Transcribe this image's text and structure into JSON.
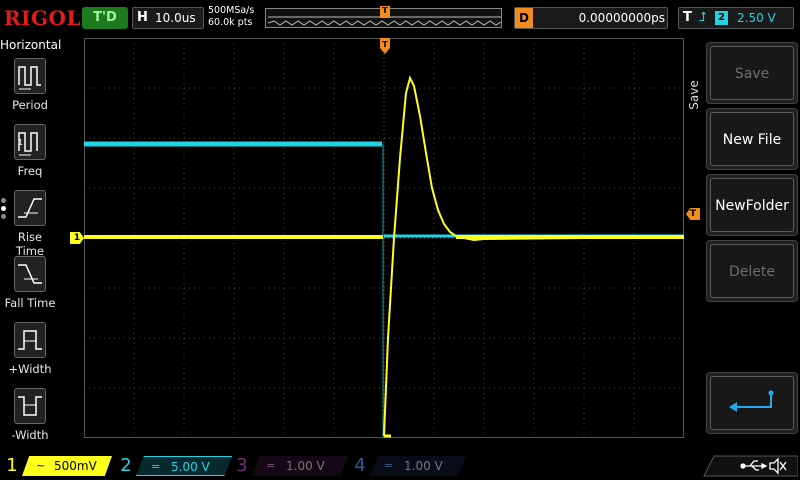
{
  "header": {
    "logo": "RIGOL",
    "run_status": "T'D",
    "timebase_label": "H",
    "timebase_value": "10.0us",
    "sample_rate": "500MSa/s",
    "memory_depth": "60.0k pts",
    "memory_trigger_label": "T",
    "delay_label": "D",
    "delay_value": "0.00000000ps",
    "trigger_label": "T",
    "trigger_source": "2",
    "trigger_level": "2.50 V"
  },
  "left_menu": {
    "title": "Horizontal",
    "items": [
      {
        "label": "Period",
        "icon": "period-icon"
      },
      {
        "label": "Freq",
        "icon": "frequency-icon"
      },
      {
        "label": "Rise Time",
        "icon": "rise-time-icon"
      },
      {
        "label": "Fall Time",
        "icon": "fall-time-icon"
      },
      {
        "label": "+Width",
        "icon": "positive-width-icon"
      },
      {
        "label": "-Width",
        "icon": "negative-width-icon"
      }
    ]
  },
  "right_menu": {
    "tab_label": "Save",
    "buttons": [
      {
        "label": "Save",
        "enabled": false
      },
      {
        "label": "New File",
        "enabled": true
      },
      {
        "label": "NewFolder",
        "enabled": true
      },
      {
        "label": "Delete",
        "enabled": false
      }
    ],
    "return_icon": "return-icon"
  },
  "markers": {
    "trigger_position": "T",
    "channel1_ground": "1",
    "trigger_level": "T"
  },
  "channels": [
    {
      "num": "1",
      "coupling": "~",
      "scale": "500mV",
      "color": "#ffff1e",
      "active": true
    },
    {
      "num": "2",
      "coupling": "=",
      "scale": "5.00 V",
      "color": "#22d3e6",
      "active": true
    },
    {
      "num": "3",
      "coupling": "=",
      "scale": "1.00 V",
      "color": "#d020d0",
      "active": false
    },
    {
      "num": "4",
      "coupling": "=",
      "scale": "1.00 V",
      "color": "#2a7de0",
      "active": false
    }
  ],
  "colors": {
    "ch1": "#ffff1e",
    "ch2": "#22d3e6",
    "trigger": "#f28c1e",
    "logo": "#e21b1b",
    "run_status_bg": "#1d7a1d"
  },
  "system_icons": [
    "usb-icon",
    "mute-icon"
  ]
}
